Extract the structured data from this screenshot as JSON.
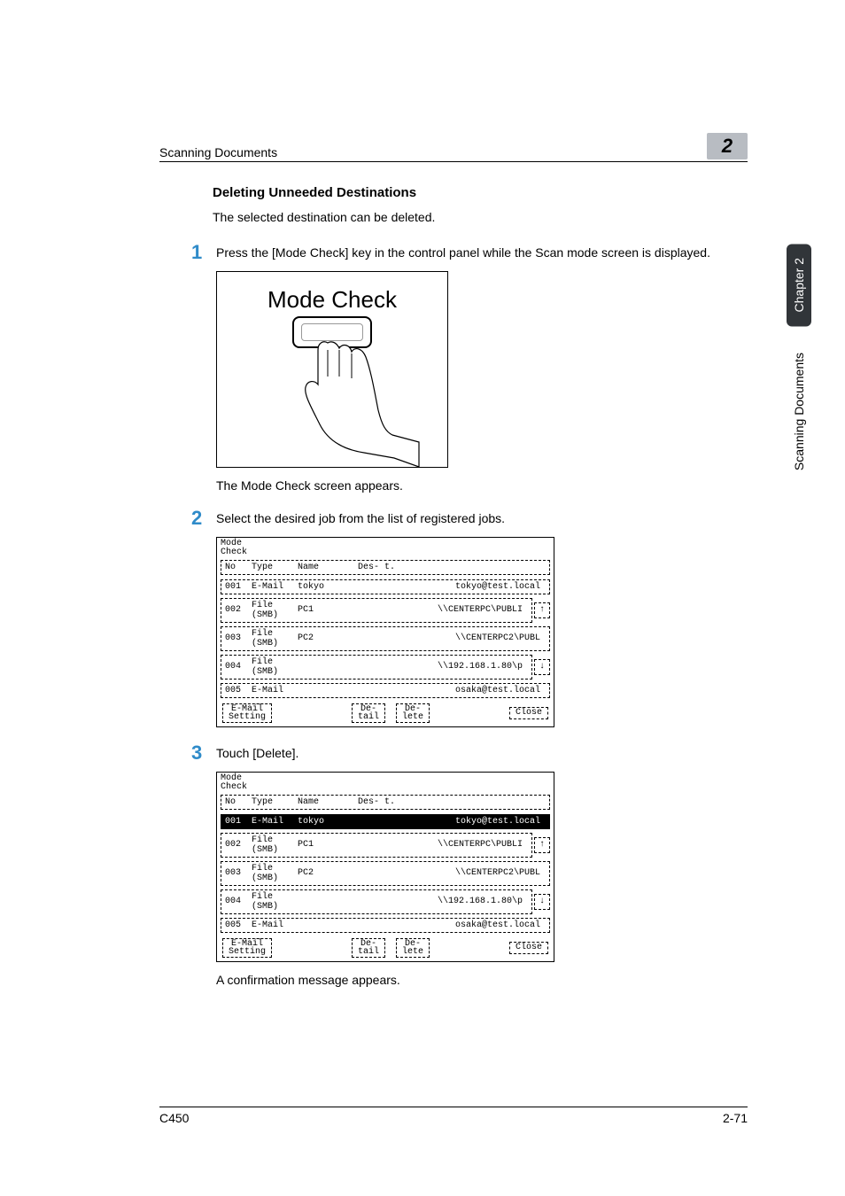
{
  "header": {
    "left": "Scanning Documents",
    "badge": "2"
  },
  "section": {
    "title": "Deleting Unneeded Destinations",
    "intro": "The selected destination can be deleted."
  },
  "steps": {
    "s1": {
      "num": "1",
      "text": "Press the [Mode Check] key in the control panel while the Scan mode screen is displayed."
    },
    "s2": {
      "num": "2",
      "text": "Select the desired job from the list of registered jobs."
    },
    "s3": {
      "num": "3",
      "text": "Touch [Delete]."
    }
  },
  "modecheck": {
    "label": "Mode Check"
  },
  "caption1": "The Mode Check screen appears.",
  "caption2": "A confirmation message appears.",
  "table": {
    "title1": "Mode",
    "title2": "Check",
    "head": {
      "no": "No",
      "type": "Type",
      "name": "Name",
      "dest": "Des-\nt."
    },
    "rows": [
      {
        "no": "001",
        "type": "E-Mail",
        "name": "tokyo",
        "dest": "tokyo@test.local"
      },
      {
        "no": "002",
        "type": "File\n(SMB)",
        "name": "PC1",
        "dest": "\\\\CENTERPC\\PUBLI"
      },
      {
        "no": "003",
        "type": "File\n(SMB)",
        "name": "PC2",
        "dest": "\\\\CENTERPC2\\PUBL"
      },
      {
        "no": "004",
        "type": "File\n(SMB)",
        "name": "",
        "dest": "\\\\192.168.1.80\\p"
      },
      {
        "no": "005",
        "type": "E-Mail",
        "name": "",
        "dest": "osaka@test.local"
      }
    ],
    "footer": {
      "email1": "E-Mail",
      "email2": "Setting",
      "detail1": "De-",
      "detail2": "tail",
      "delete1": "De-",
      "delete2": "lete",
      "close": "Close"
    },
    "arrows": {
      "up": "↑",
      "down": "↓"
    }
  },
  "sidetabs": {
    "dark": "Chapter 2",
    "light": "Scanning Documents"
  },
  "footer": {
    "left": "C450",
    "right": "2-71"
  }
}
